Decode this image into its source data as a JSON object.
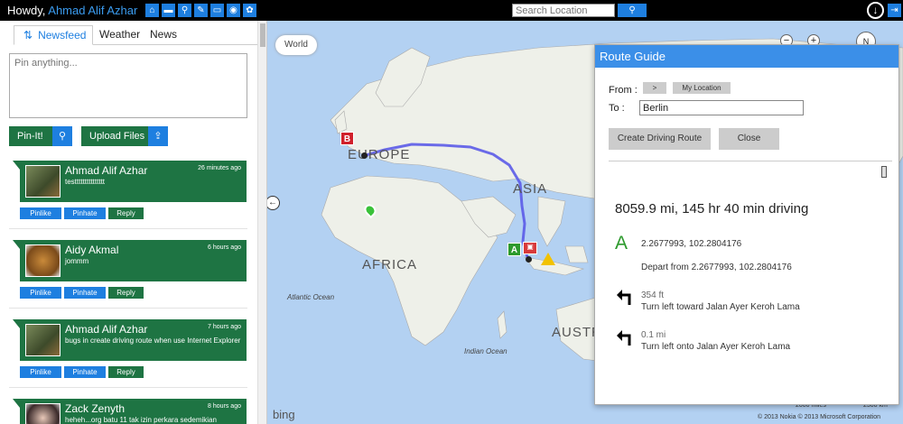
{
  "header": {
    "greeting": "Howdy, ",
    "username": "Ahmad Alif Azhar",
    "nav_icons": [
      "home-icon",
      "chat-icon",
      "search-icon",
      "tools-icon",
      "card-icon",
      "car-icon",
      "settings-icon"
    ],
    "search_placeholder": "Search Location"
  },
  "sidebar": {
    "tabs": [
      {
        "label": "Newsfeed",
        "icon": "refresh-icon"
      },
      {
        "label": "Weather"
      },
      {
        "label": "News"
      }
    ],
    "pin_placeholder": "Pin anything...",
    "pinit_label": "Pin-It!",
    "upload_label": "Upload Files",
    "posts": [
      {
        "name": "Ahmad Alif Azhar",
        "time": "26 minutes ago",
        "body": "testtttttttttttttt"
      },
      {
        "name": "Aidy Akmal",
        "time": "6 hours ago",
        "body": "jommm"
      },
      {
        "name": "Ahmad Alif Azhar",
        "time": "7 hours ago",
        "body": "bugs in create driving route when use Internet Explorer"
      },
      {
        "name": "Zack Zenyth",
        "time": "8 hours ago",
        "body": "heheh...org batu 11 tak izin perkara sedemikian"
      }
    ],
    "actions": {
      "pinlike": "Pinlike",
      "pinhate": "Pinhate",
      "reply": "Reply"
    }
  },
  "map": {
    "world_label": "World",
    "labels": {
      "europe": "EUROPE",
      "asia": "ASIA",
      "africa": "AFRICA",
      "austr": "AUSTR",
      "atlantic": "Atlantic Ocean",
      "indian": "Indian Ocean"
    },
    "marker_b": "B",
    "marker_a": "A",
    "bing": "bing",
    "copyright": "© 2013 Nokia   © 2013 Microsoft Corporation",
    "scale_miles": "2000 miles",
    "scale_km": "2500 km"
  },
  "route": {
    "title": "Route Guide",
    "from_label": "From :",
    "arrow_button": ">",
    "my_location_button": "My Location",
    "to_label": "To      :",
    "to_value": "Berlin",
    "create_button": "Create Driving Route",
    "close_button": "Close",
    "summary": "8059.9 mi, 145 hr 40 min driving",
    "start_letter": "A",
    "start_coord": "2.2677993, 102.2804176",
    "depart": "Depart from 2.2677993, 102.2804176",
    "steps": [
      {
        "distance": "354 ft",
        "instruction": "Turn left toward Jalan Ayer Keroh Lama",
        "icon": "turn-left-icon"
      },
      {
        "distance": "0.1 mi",
        "instruction": "Turn left onto Jalan Ayer Keroh Lama",
        "icon": "turn-left-icon"
      }
    ]
  },
  "colors": {
    "topbar": "#000000",
    "accent_blue": "#1e7fe0",
    "post_green": "#1e7443",
    "route_header": "#3b8fe8",
    "route_line": "#5b5be8",
    "water": "#b3d1f2",
    "land": "#eef0e9"
  }
}
